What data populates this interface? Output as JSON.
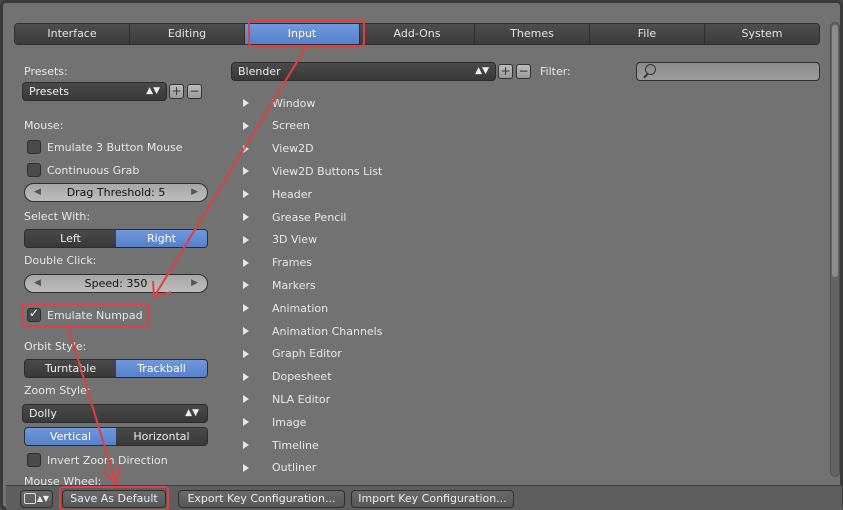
{
  "tabs": [
    "Interface",
    "Editing",
    "Input",
    "Add-Ons",
    "Themes",
    "File",
    "System"
  ],
  "left": {
    "presets_label": "Presets:",
    "presets_value": "Presets",
    "mouse_label": "Mouse:",
    "emulate_3_button": "Emulate 3 Button Mouse",
    "continuous_grab": "Continuous Grab",
    "drag_threshold": "Drag Threshold: 5",
    "select_with_label": "Select With:",
    "select_left": "Left",
    "select_right": "Right",
    "double_click_label": "Double Click:",
    "speed": "Speed: 350",
    "emulate_numpad": "Emulate Numpad",
    "orbit_style_label": "Orbit Style:",
    "orbit_turntable": "Turntable",
    "orbit_trackball": "Trackball",
    "zoom_style_label": "Zoom Style:",
    "zoom_style_value": "Dolly",
    "zoom_vertical": "Vertical",
    "zoom_horizontal": "Horizontal",
    "invert_zoom": "Invert Zoom Direction",
    "mouse_wheel_label": "Mouse Wheel:"
  },
  "keymap": {
    "preset_value": "Blender",
    "filter_label": "Filter:",
    "items": [
      "Window",
      "Screen",
      "View2D",
      "View2D Buttons List",
      "Header",
      "Grease Pencil",
      "3D View",
      "Frames",
      "Markers",
      "Animation",
      "Animation Channels",
      "Graph Editor",
      "Dopesheet",
      "NLA Editor",
      "Image",
      "Timeline",
      "Outliner"
    ]
  },
  "bottom": {
    "save_default": "Save As Default",
    "export_keys": "Export Key Configuration...",
    "import_keys": "Import Key Configuration..."
  },
  "colors": {
    "annotation": "#e0403f",
    "accent": "#5680c9"
  }
}
